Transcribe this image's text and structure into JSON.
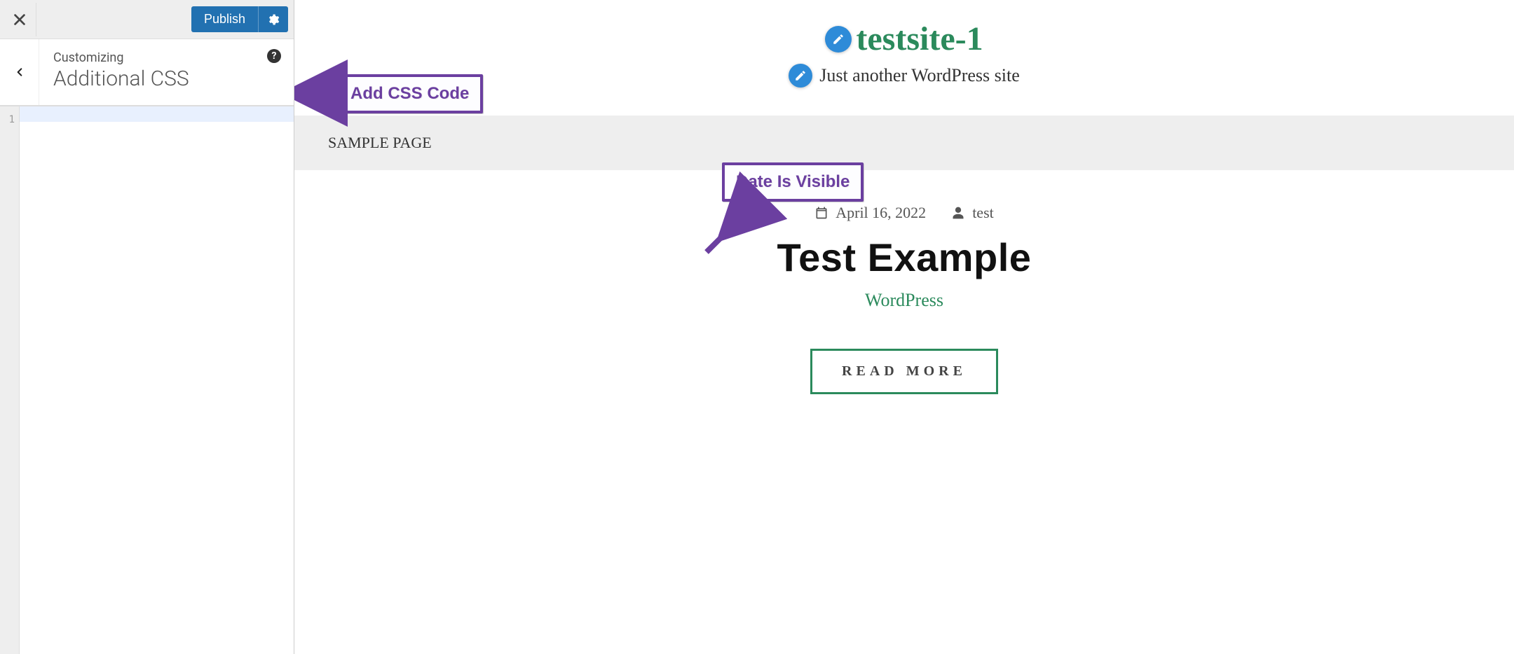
{
  "customizer": {
    "publish_label": "Publish",
    "breadcrumb": "Customizing",
    "panel_title": "Additional CSS",
    "help_symbol": "?",
    "line_number": "1",
    "code_value": ""
  },
  "preview": {
    "site_title": "testsite-1",
    "tagline": "Just another WordPress site",
    "nav_item": "SAMPLE PAGE",
    "post": {
      "date": "April 16, 2022",
      "author": "test",
      "title": "Test Example",
      "category": "WordPress",
      "read_more": "READ MORE"
    }
  },
  "annotations": {
    "add_css": "Add CSS Code",
    "date_visible": "Date Is Visible"
  }
}
